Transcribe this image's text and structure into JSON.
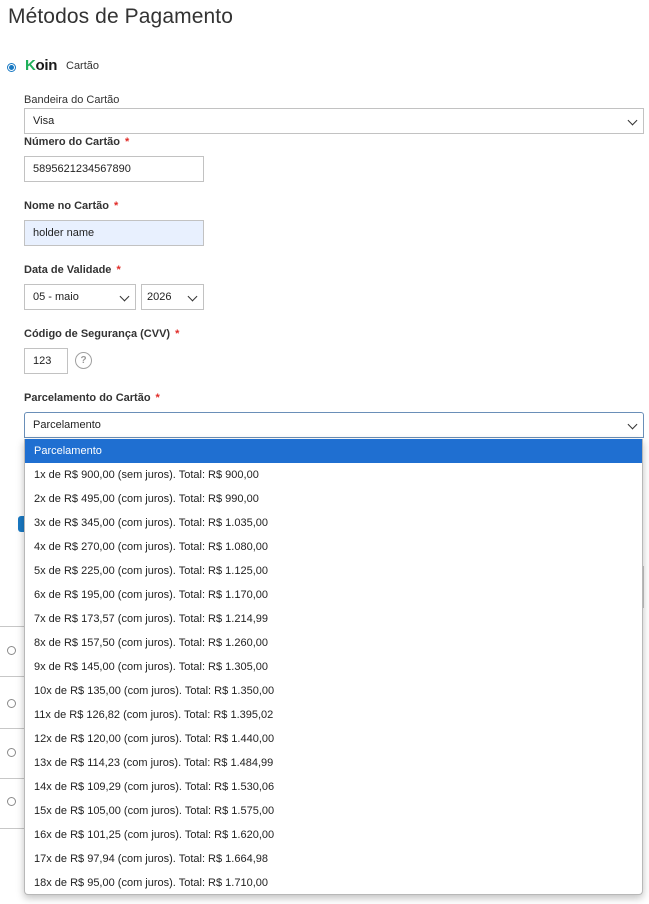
{
  "page": {
    "title": "Métodos de Pagamento"
  },
  "payment_method": {
    "brand_logo_text": "Koin",
    "brand_logo_k": "K",
    "brand_logo_rest": "oin",
    "name": "Cartão"
  },
  "fields": {
    "card_brand": {
      "label": "Bandeira do Cartão",
      "value": "Visa"
    },
    "card_number": {
      "label": "Número do Cartão",
      "value": "5895621234567890"
    },
    "card_name": {
      "label": "Nome no Cartão",
      "value": "holder name"
    },
    "expiry": {
      "label": "Data de Validade",
      "month": "05 - maio",
      "year": "2026"
    },
    "cvv": {
      "label": "Código de Segurança (CVV)",
      "value": "123",
      "help_icon": "question-icon",
      "help_glyph": "?"
    },
    "installments": {
      "label": "Parcelamento do Cartão",
      "value": "Parcelamento"
    },
    "required_mark": "*"
  },
  "installment_options": [
    "Parcelamento",
    "1x de R$ 900,00 (sem juros). Total: R$ 900,00",
    "2x de R$ 495,00 (com juros). Total: R$ 990,00",
    "3x de R$ 345,00 (com juros). Total: R$ 1.035,00",
    "4x de R$ 270,00 (com juros). Total: R$ 1.080,00",
    "5x de R$ 225,00 (com juros). Total: R$ 1.125,00",
    "6x de R$ 195,00 (com juros). Total: R$ 1.170,00",
    "7x de R$ 173,57 (com juros). Total: R$ 1.214,99",
    "8x de R$ 157,50 (com juros). Total: R$ 1.260,00",
    "9x de R$ 145,00 (com juros). Total: R$ 1.305,00",
    "10x de R$ 135,00 (com juros). Total: R$ 1.350,00",
    "11x de R$ 126,82 (com juros). Total: R$ 1.395,02",
    "12x de R$ 120,00 (com juros). Total: R$ 1.440,00",
    "13x de R$ 114,23 (com juros). Total: R$ 1.484,99",
    "14x de R$ 109,29 (com juros). Total: R$ 1.530,06",
    "15x de R$ 105,00 (com juros). Total: R$ 1.575,00",
    "16x de R$ 101,25 (com juros). Total: R$ 1.620,00",
    "17x de R$ 97,94 (com juros). Total: R$ 1.664,98",
    "18x de R$ 95,00 (com juros). Total: R$ 1.710,00"
  ],
  "colors": {
    "accent": "#1979c3",
    "selected_option": "#1f6fd1",
    "required": "#e02b27",
    "koin_green": "#1fb05a",
    "autofill": "#e8f0fe"
  }
}
